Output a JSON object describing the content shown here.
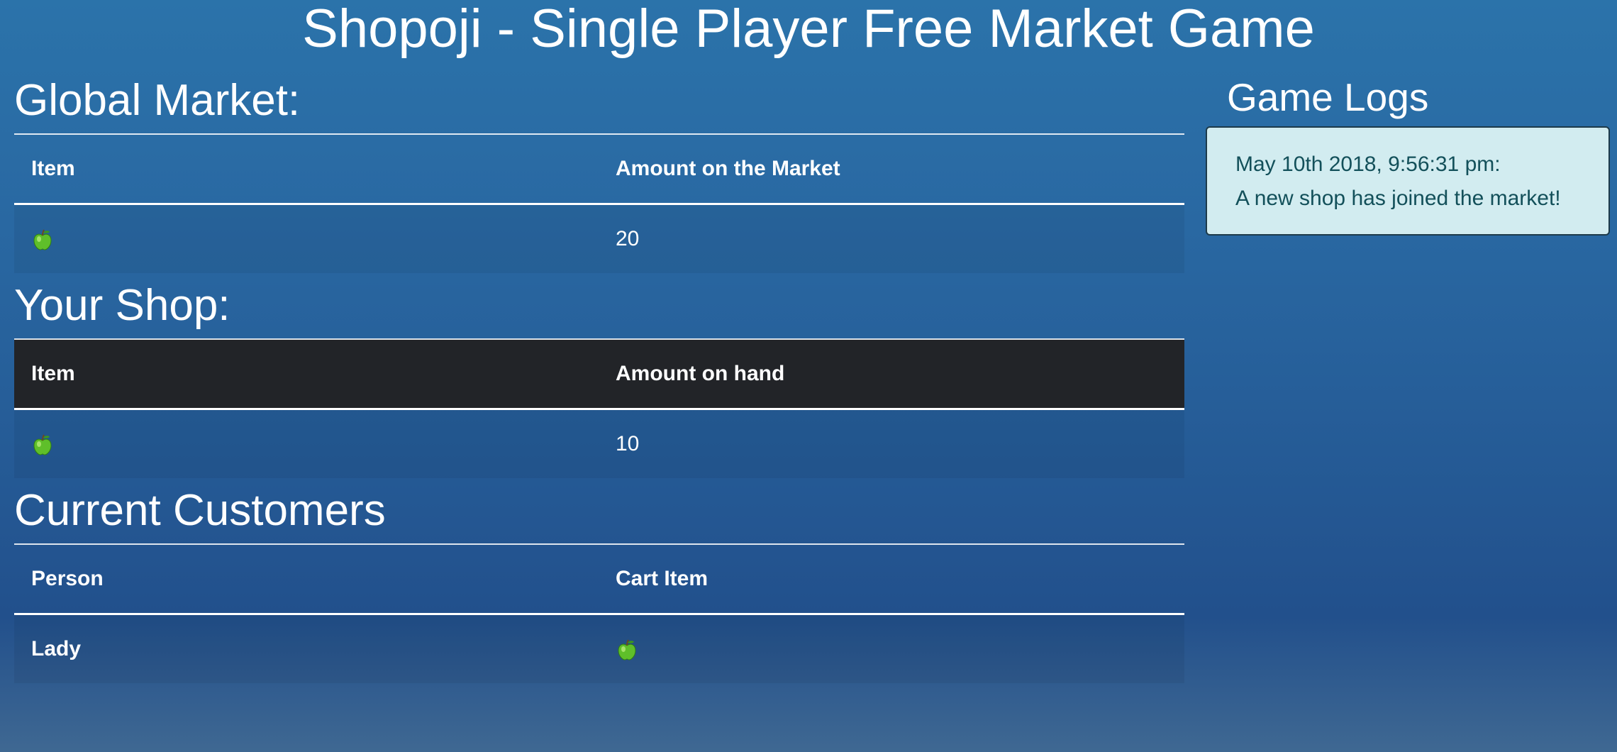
{
  "page": {
    "title": "Shopoji - Single Player Free Market Game"
  },
  "global_market": {
    "title": "Global Market:",
    "columns": [
      "Item",
      "Amount on the Market"
    ],
    "rows": [
      {
        "item_icon": "green-apple",
        "amount": "20"
      }
    ]
  },
  "your_shop": {
    "title": "Your Shop:",
    "columns": [
      "Item",
      "Amount on hand"
    ],
    "rows": [
      {
        "item_icon": "green-apple",
        "amount": "10"
      }
    ]
  },
  "current_customers": {
    "title": "Current Customers",
    "columns": [
      "Person",
      "Cart Item"
    ],
    "rows": [
      {
        "person": "Lady",
        "cart_item_icon": "green-apple"
      }
    ]
  },
  "game_logs": {
    "title": "Game Logs",
    "entries": [
      {
        "timestamp": "May 10th 2018, 9:56:31 pm:",
        "message": "A new shop has joined the market!"
      }
    ]
  },
  "colors": {
    "background_top": "#2b73aa",
    "background_bottom": "#22508c",
    "shop_header": "#222428",
    "shop_row": "#2d3035",
    "log_box_bg": "#d2ecf0",
    "log_text": "#13505a",
    "apple_green": "#5fbf2a"
  }
}
